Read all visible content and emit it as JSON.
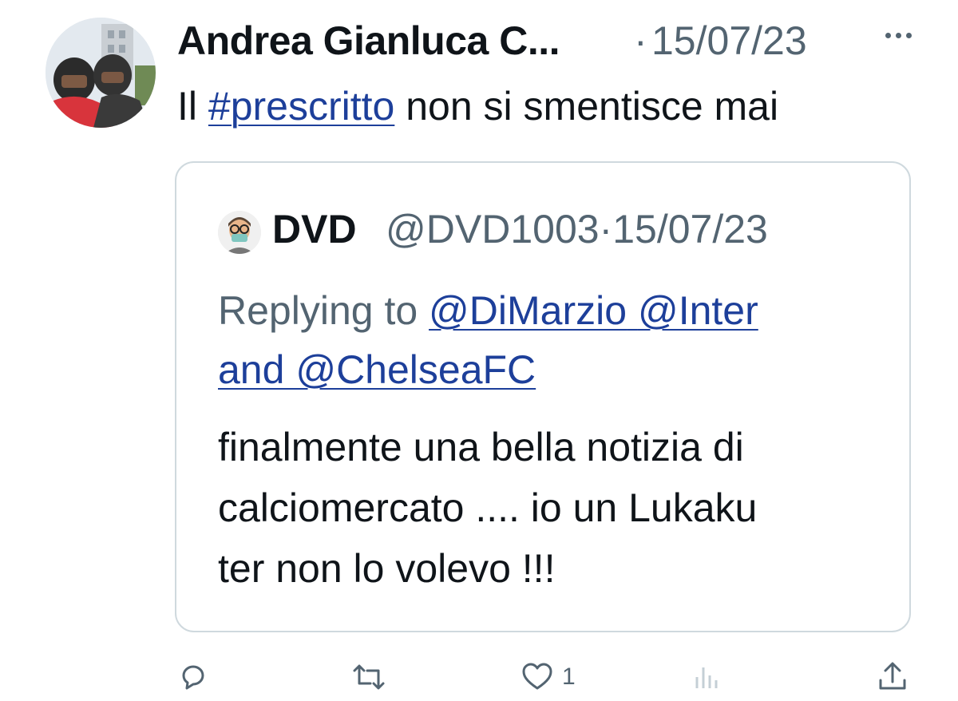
{
  "author": {
    "name": "Andrea Gianluca C...",
    "separator": "·",
    "date": "15/07/23"
  },
  "tweet": {
    "prefix": "Il ",
    "hashtag": "#prescritto",
    "suffix": " non si smentisce mai"
  },
  "quoted": {
    "name": "DVD",
    "handle": "@DVD1003·15/07/23",
    "replying_prefix": "Replying to ",
    "mention1": "@DiMarzio",
    "mention2": "@Inter",
    "mention3_line": "and @ChelseaFC",
    "body": [
      "finalmente una bella notizia di",
      "calciomercato .... io un Lukaku",
      "ter non lo volevo !!!"
    ]
  },
  "actions": {
    "reply": "reply-icon",
    "retweet": "retweet-icon",
    "like": "heart-icon",
    "like_count": "1",
    "views": "views-icon",
    "share": "share-icon"
  },
  "colors": {
    "link": "#1d3f9a",
    "secondary": "#536471",
    "border": "#cfd9de"
  }
}
